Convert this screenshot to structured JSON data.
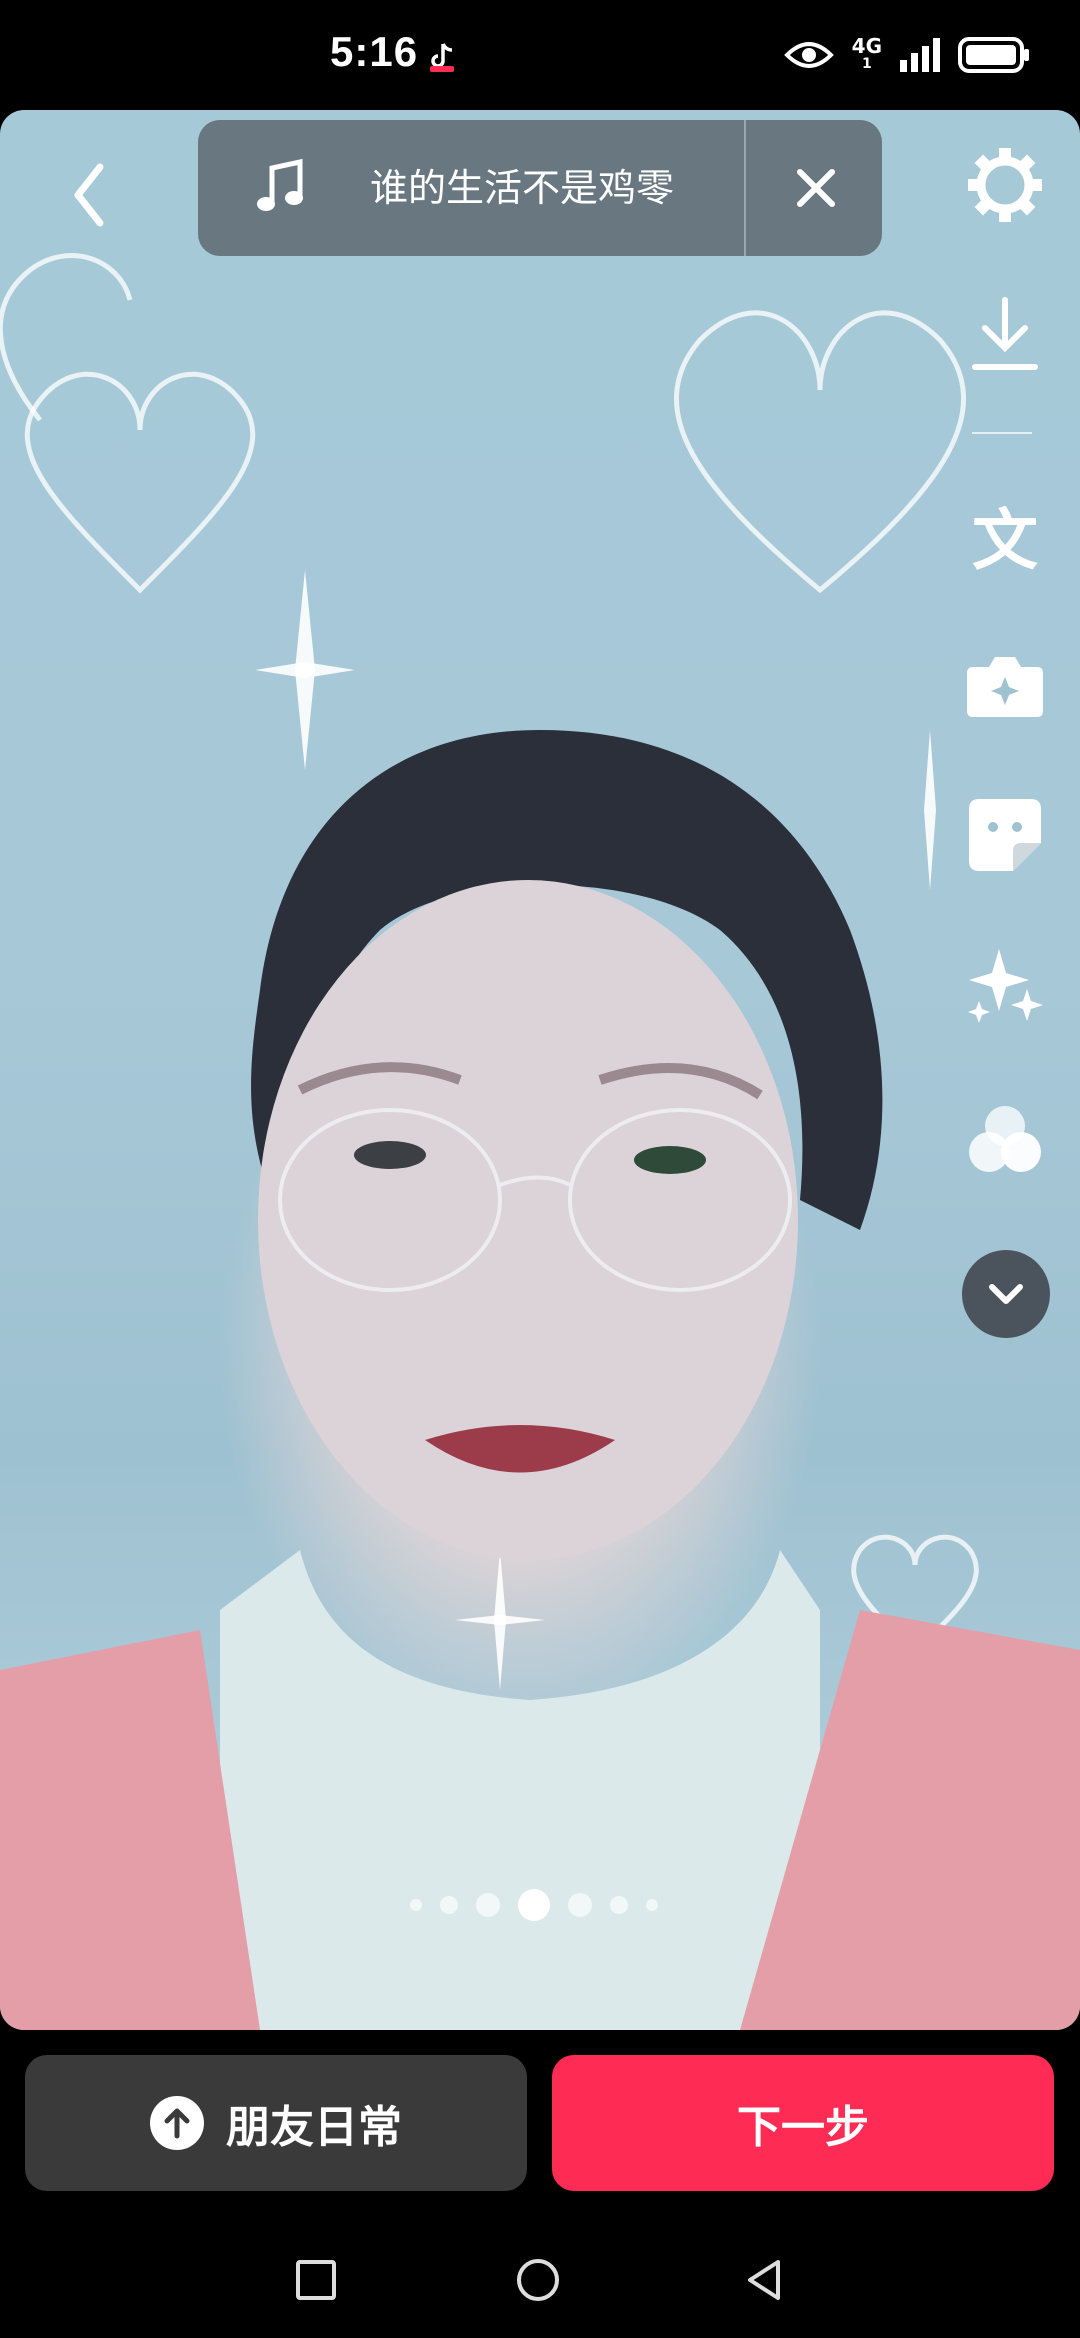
{
  "status_bar": {
    "time": "5:16",
    "network_top": "4G",
    "network_bottom": "1"
  },
  "top_bar": {
    "music_title": "谁的生活不是鸡零"
  },
  "right_toolbar": {
    "text_tool_glyph": "文",
    "tools": [
      "settings-icon",
      "download-icon",
      "text-icon",
      "camera-plus-icon",
      "sticker-icon",
      "effects-sparkle-icon",
      "filters-icon",
      "chevron-down-icon"
    ]
  },
  "pager": {
    "total": 7,
    "active_index": 3
  },
  "bottom_actions": {
    "daily_label": "朋友日常",
    "next_label": "下一步"
  },
  "colors": {
    "accent": "#fe2c55",
    "secondary_button": "#3a3a3a"
  }
}
